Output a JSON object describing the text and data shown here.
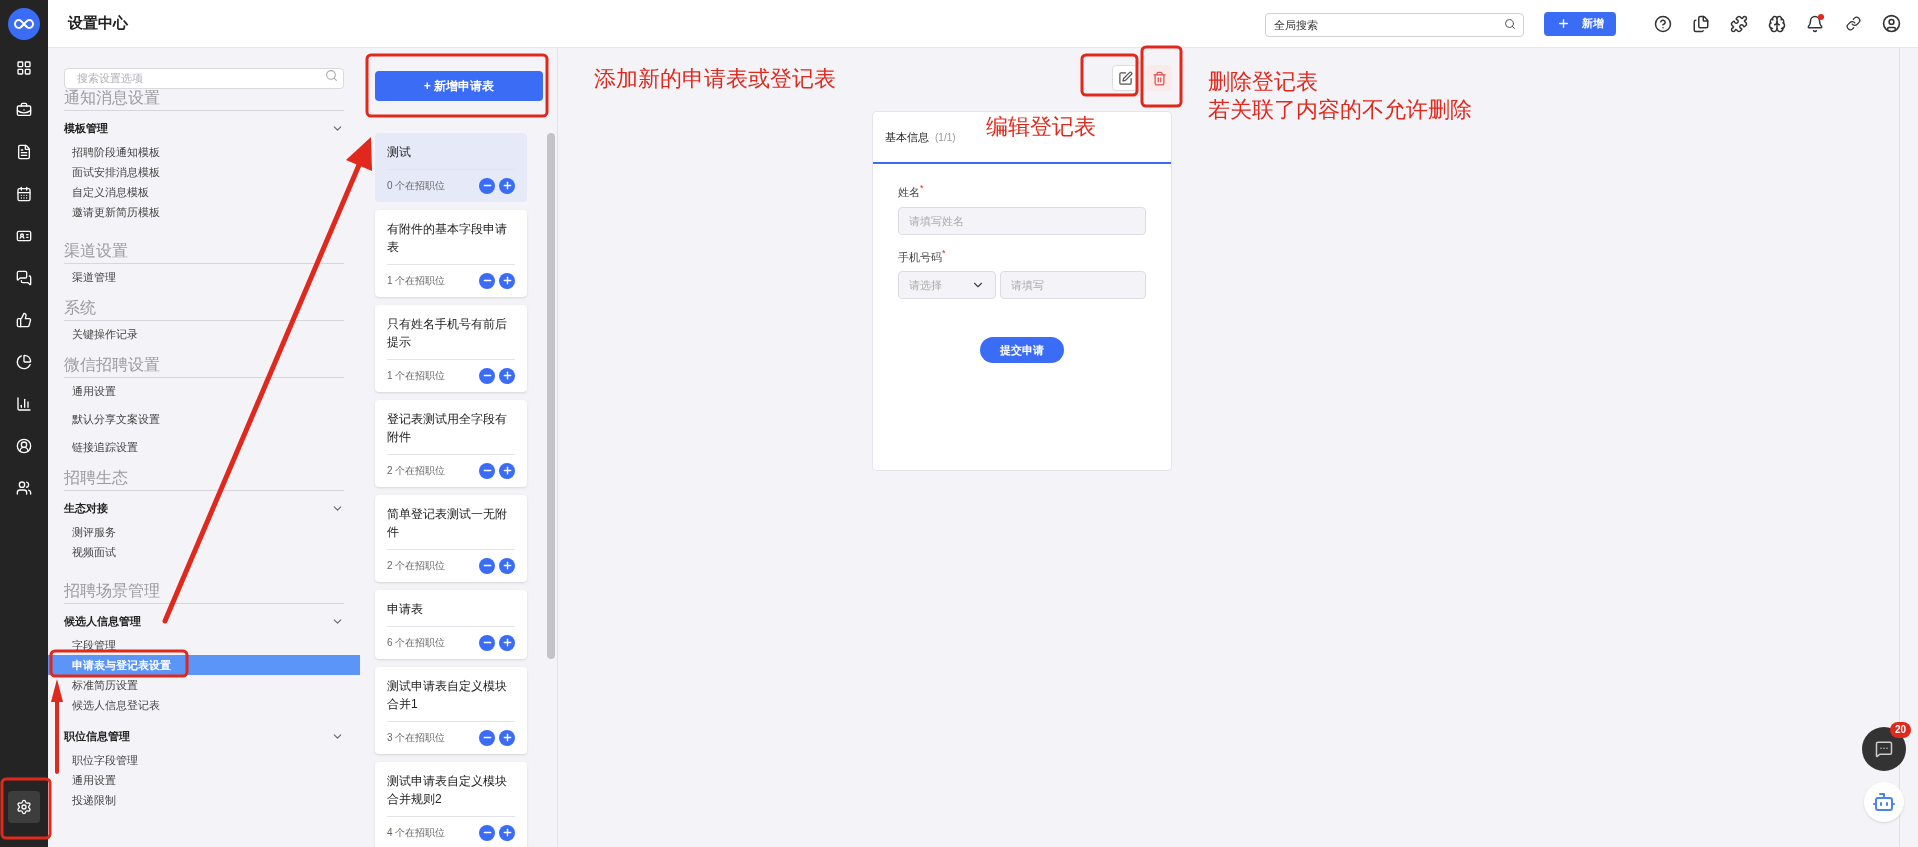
{
  "header": {
    "title": "设置中心",
    "search": {
      "placeholder": "全局搜索"
    },
    "new_button": "新增",
    "notification_dot": true
  },
  "rail": {
    "items": [
      {
        "selected": false
      },
      {
        "selected": false
      },
      {
        "selected": false
      },
      {
        "selected": false
      },
      {
        "selected": false
      },
      {
        "selected": false
      },
      {
        "selected": false
      },
      {
        "selected": false
      },
      {
        "selected": false
      },
      {
        "selected": false
      },
      {
        "selected": false
      }
    ],
    "settings": {
      "selected": true
    }
  },
  "sidebar": {
    "search": {
      "placeholder": "搜索设置选项"
    },
    "sections": [
      {
        "title": "通知消息设置",
        "groups": [
          {
            "title": "模板管理",
            "expanded": true,
            "items": [
              {
                "label": "招聘阶段通知模板",
                "selected": false
              },
              {
                "label": "面试安排消息模板",
                "selected": false
              },
              {
                "label": "自定义消息模板",
                "selected": false
              },
              {
                "label": "邀请更新简历模板",
                "selected": false
              }
            ]
          }
        ]
      },
      {
        "title": "渠道设置",
        "items": [
          {
            "label": "渠道管理",
            "selected": false
          }
        ]
      },
      {
        "title": "系统",
        "items": [
          {
            "label": "关键操作记录",
            "selected": false
          }
        ]
      },
      {
        "title": "微信招聘设置",
        "items": [
          {
            "label": "通用设置",
            "selected": false
          },
          {
            "label": "默认分享文案设置",
            "selected": false
          },
          {
            "label": "链接追踪设置",
            "selected": false
          }
        ]
      },
      {
        "title": "招聘生态",
        "groups": [
          {
            "title": "生态对接",
            "expanded": true,
            "items": [
              {
                "label": "测评服务",
                "selected": false
              },
              {
                "label": "视频面试",
                "selected": false
              }
            ]
          }
        ]
      },
      {
        "title": "招聘场景管理",
        "groups": [
          {
            "title": "候选人信息管理",
            "expanded": true,
            "items": [
              {
                "label": "字段管理",
                "selected": false
              },
              {
                "label": "申请表与登记表设置",
                "selected": true
              },
              {
                "label": "标准简历设置",
                "selected": false
              },
              {
                "label": "候选人信息登记表",
                "selected": false
              }
            ]
          },
          {
            "title": "职位信息管理",
            "expanded": true,
            "items": [
              {
                "label": "职位字段管理",
                "selected": false
              },
              {
                "label": "通用设置",
                "selected": false
              },
              {
                "label": "投递限制",
                "selected": false
              }
            ]
          }
        ]
      }
    ]
  },
  "form_list": {
    "add_button": "+ 新增申请表",
    "forms": [
      {
        "name": "测试",
        "count": "0 个在招职位",
        "selected": true
      },
      {
        "name": "有附件的基本字段申请表",
        "count": "1 个在招职位",
        "selected": false
      },
      {
        "name": "只有姓名手机号有前后提示",
        "count": "1 个在招职位",
        "selected": false
      },
      {
        "name": "登记表测试用全字段有附件",
        "count": "2 个在招职位",
        "selected": false
      },
      {
        "name": "简单登记表测试一无附件",
        "count": "2 个在招职位",
        "selected": false
      },
      {
        "name": "申请表",
        "count": "6 个在招职位",
        "selected": false
      },
      {
        "name": "测试申请表自定义模块合并1",
        "count": "3 个在招职位",
        "selected": false
      },
      {
        "name": "测试申请表自定义模块合并规则2",
        "count": "4 个在招职位",
        "selected": false
      }
    ]
  },
  "preview": {
    "tab": {
      "label": "基本信息",
      "count": "(1/1)"
    },
    "fields": [
      {
        "kind": "text",
        "label": "姓名",
        "required": true,
        "required_mark": "*",
        "placeholder": "请填写姓名"
      },
      {
        "kind": "phone",
        "label": "手机号码",
        "required": true,
        "required_mark": "*",
        "select_placeholder": "请选择",
        "placeholder": "请填写"
      }
    ],
    "submit": "提交申请"
  },
  "chat": {
    "badge": "20"
  },
  "annotations": {
    "add": "添加新的申请表或登记表",
    "edit": "编辑登记表",
    "delete": [
      "删除登记表",
      "若关联了内容的不允许删除"
    ]
  }
}
